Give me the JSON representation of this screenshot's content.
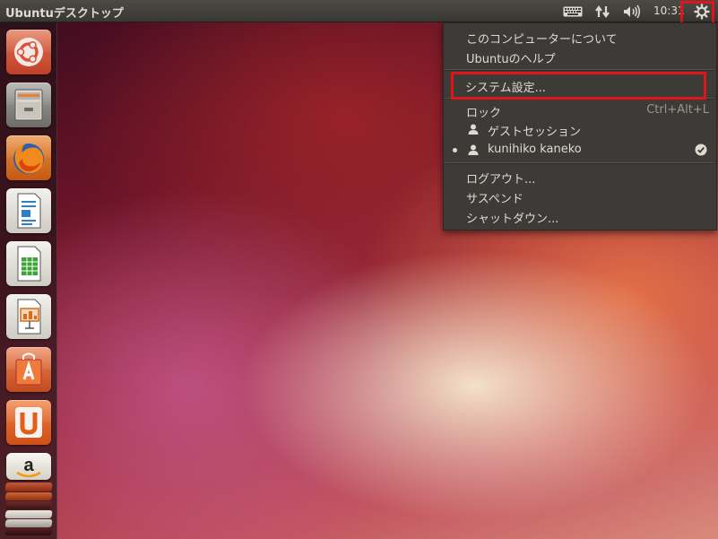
{
  "top_panel": {
    "title": "Ubuntuデスクトップ",
    "clock": "10:31",
    "indicators": [
      "keyboard-icon",
      "network-icon",
      "volume-icon",
      "gear-icon"
    ]
  },
  "launcher": {
    "items": [
      {
        "name": "dash-home",
        "icon": "ubuntu-logo-icon",
        "color": "#d8533a"
      },
      {
        "name": "files",
        "icon": "file-cabinet-icon",
        "color": "#6b6a66"
      },
      {
        "name": "firefox",
        "icon": "firefox-icon",
        "color": "#e06a1b"
      },
      {
        "name": "libreoffice-writer",
        "icon": "writer-document-icon",
        "color": "#2f7fc4"
      },
      {
        "name": "libreoffice-calc",
        "icon": "calc-spreadsheet-icon",
        "color": "#3ea336"
      },
      {
        "name": "libreoffice-impress",
        "icon": "impress-presentation-icon",
        "color": "#d86b1e"
      },
      {
        "name": "software-center",
        "icon": "shopping-bag-icon",
        "color": "#e1602a"
      },
      {
        "name": "ubuntu-one",
        "icon": "ubuntu-one-icon",
        "color": "#e35e1d"
      },
      {
        "name": "amazon",
        "icon": "amazon-icon",
        "color": "#f4f1e8"
      }
    ]
  },
  "system_menu": {
    "items": [
      {
        "label": "このコンピューターについて"
      },
      {
        "label": "Ubuntuのヘルプ"
      },
      {
        "label": "システム設定..."
      },
      {
        "label": "ロック",
        "accel": "Ctrl+Alt+L"
      },
      {
        "label": "ゲストセッション"
      },
      {
        "label": "kunihiko kaneko"
      },
      {
        "label": "ログアウト..."
      },
      {
        "label": "サスペンド"
      },
      {
        "label": "シャットダウン..."
      }
    ]
  },
  "colors": {
    "panel": "#3c3b37",
    "panel_text": "#dfdbd2",
    "highlight_box": "#e0141a"
  }
}
